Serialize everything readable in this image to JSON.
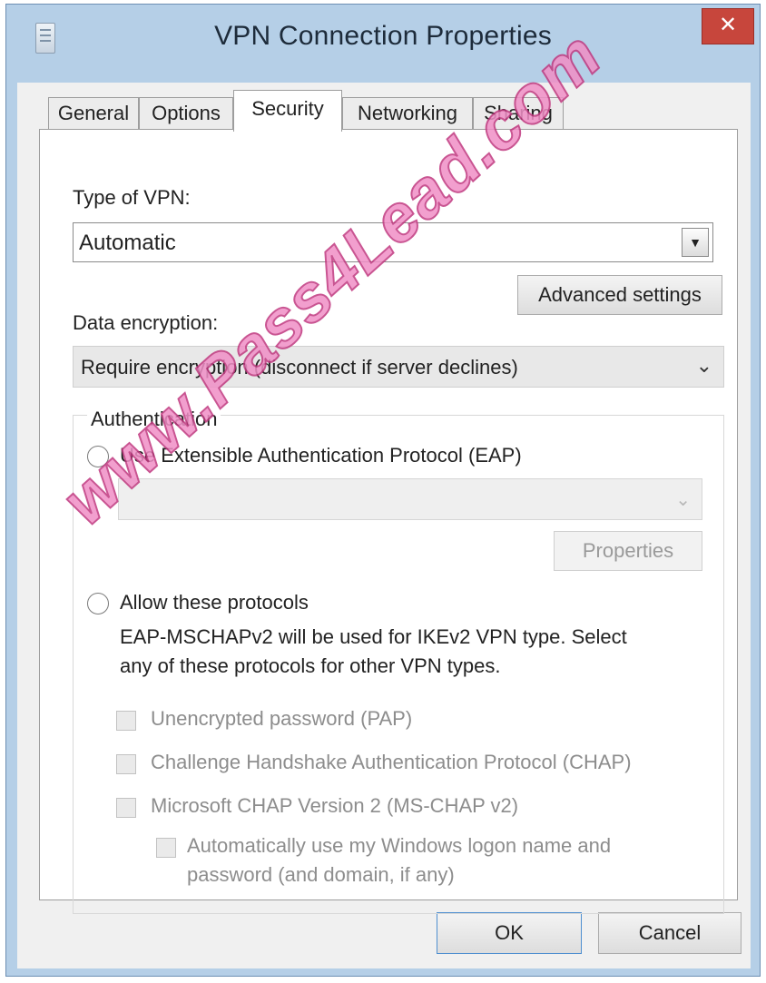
{
  "window": {
    "title": "VPN Connection Properties",
    "close_glyph": "✕"
  },
  "tabs": [
    "General",
    "Options",
    "Security",
    "Networking",
    "Sharing"
  ],
  "active_tab": "Security",
  "security": {
    "vpn_type_label": "Type of VPN:",
    "vpn_type_value": "Automatic",
    "advanced_button": "Advanced settings",
    "encryption_label": "Data encryption:",
    "encryption_value": "Require encryption (disconnect if server declines)",
    "auth_group_title": "Authentication",
    "eap_radio_label": "Use Extensible Authentication Protocol (EAP)",
    "eap_select_value": "",
    "properties_button": "Properties",
    "allow_radio_label": "Allow these protocols",
    "info_line1": "EAP-MSCHAPv2 will be used for IKEv2 VPN type. Select",
    "info_line2": "any of these protocols for other VPN types.",
    "checkbox_pap": "Unencrypted password (PAP)",
    "checkbox_chap": "Challenge Handshake Authentication Protocol (CHAP)",
    "checkbox_mschap": "Microsoft CHAP Version 2 (MS-CHAP v2)",
    "checkbox_autologon_line1": "Automatically use my Windows logon name and",
    "checkbox_autologon_line2": "password (and domain, if any)"
  },
  "footer": {
    "ok_label": "OK",
    "cancel_label": "Cancel"
  },
  "watermark": "www.Pass4Lead.com",
  "icons": {
    "app": "vpn-connection-icon",
    "close": "close-icon",
    "combo_arrow": "dropdown-arrow-icon",
    "chevron": "chevron-down-icon"
  },
  "colors": {
    "titlebar": "#b5cfe7",
    "close": "#c7463c",
    "watermark": "#f08fc6"
  }
}
